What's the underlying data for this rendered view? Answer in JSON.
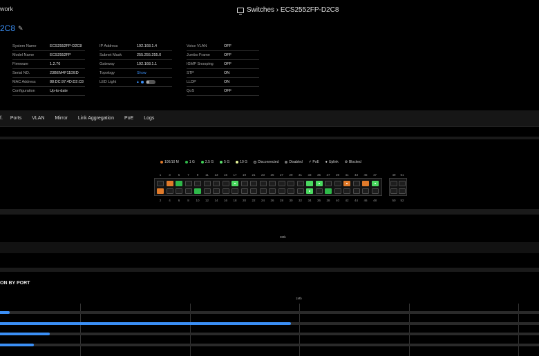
{
  "header": {
    "nav_text": "work",
    "title": "Switches › ECS2552FP-D2C8"
  },
  "device": {
    "name": "2C8"
  },
  "info": {
    "col1": [
      {
        "k": "System Name",
        "v": "ECS2552FP-D2C8"
      },
      {
        "k": "Model Name",
        "v": "ECS2552FP"
      },
      {
        "k": "Firmware",
        "v": "1.2.76"
      },
      {
        "k": "Serial NO.",
        "v": "23BEM4F11DED"
      },
      {
        "k": "MAC Address",
        "v": "88:DC:97:4D:D2:C8"
      },
      {
        "k": "Configuration",
        "v": "Up-to-date"
      }
    ],
    "col2": [
      {
        "k": "IP Address",
        "v": "192.168.1.4"
      },
      {
        "k": "Subnet Mask",
        "v": "255.255.255.0"
      },
      {
        "k": "Gateway",
        "v": "192.168.1.1"
      },
      {
        "k": "Topology",
        "v": "Show"
      },
      {
        "k": "LED Light",
        "v": ""
      }
    ],
    "col3": [
      {
        "k": "Voice VLAN",
        "v": "OFF"
      },
      {
        "k": "Jumbo Frame",
        "v": "OFF"
      },
      {
        "k": "IGMP Snooping",
        "v": "OFF"
      },
      {
        "k": "STP",
        "v": "ON"
      },
      {
        "k": "LLDP",
        "v": "ON"
      },
      {
        "k": "QoS",
        "v": "OFF"
      }
    ]
  },
  "tabs": [
    "f.",
    "Ports",
    "VLAN",
    "Mirror",
    "Link Aggregation",
    "PoE",
    "Logs"
  ],
  "legend": [
    {
      "label": "100/10 M",
      "color": "#e07a2a"
    },
    {
      "label": "1 G",
      "color": "#2fb84a"
    },
    {
      "label": "2.5 G",
      "color": "#3fcf55"
    },
    {
      "label": "5 G",
      "color": "#5ee06e"
    },
    {
      "label": "10 G",
      "color": "#e6f59a"
    },
    {
      "label": "Disconnected",
      "color": "#000000",
      "ring": true
    },
    {
      "label": "Disabled",
      "color": "#777777"
    },
    {
      "label": "PoE",
      "icon": "bolt-icon"
    },
    {
      "label": "Uplink",
      "icon": "uplink-icon"
    },
    {
      "label": "Blocked",
      "icon": "blocked-icon"
    }
  ],
  "ports": {
    "top_numbers": [
      "1",
      "3",
      "5",
      "7",
      "9",
      "11",
      "13",
      "15",
      "17",
      "19",
      "21",
      "23",
      "25",
      "27",
      "29",
      "31",
      "33",
      "35",
      "37",
      "39",
      "41",
      "43",
      "45",
      "47"
    ],
    "bottom_numbers": [
      "2",
      "4",
      "6",
      "8",
      "10",
      "12",
      "14",
      "16",
      "18",
      "20",
      "22",
      "24",
      "26",
      "28",
      "30",
      "32",
      "34",
      "36",
      "38",
      "40",
      "42",
      "44",
      "46",
      "48"
    ],
    "top_states": [
      "off",
      "orange",
      "green",
      "off",
      "off",
      "off",
      "off",
      "off",
      "bright-poe",
      "off",
      "off",
      "off",
      "off",
      "off",
      "off",
      "off",
      "bright",
      "bright-poe",
      "off",
      "off",
      "orange-poe",
      "off",
      "orange",
      "bright-poe"
    ],
    "bottom_states": [
      "orange",
      "off",
      "off",
      "off",
      "green",
      "off",
      "off",
      "off",
      "off",
      "off",
      "off",
      "off",
      "off",
      "off",
      "off",
      "off",
      "bright-poe",
      "off",
      "green",
      "off",
      "off",
      "off",
      "off",
      "off"
    ],
    "sfp_top": [
      "49",
      "51"
    ],
    "sfp_bottom": [
      "50",
      "52"
    ]
  },
  "charts": {
    "mid_label": "0Mb",
    "bottom_title": "ON BY PORT",
    "bottom_tick": "1Mb",
    "bars": [
      0.018,
      0.54,
      0.092,
      0.063
    ]
  }
}
